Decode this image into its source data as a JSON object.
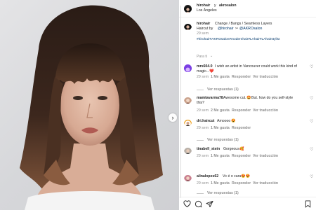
{
  "post": {
    "header": {
      "author": "hirohair",
      "connector": "y",
      "collab": "akrosalon",
      "location": "Los Ángeles"
    },
    "caption": {
      "username": "hirohair",
      "line1": "Change / Bangs / Seamless Layers",
      "line2_prefix": "Haircut by",
      "mention_hiro": "@hirohair",
      "mention_akro": "@AKROsalon",
      "hashtags": "#hirohair#AKROsalon#modernhair#LAhair#LAhairstylist",
      "time": "29 sem"
    },
    "for_you": "Para ti",
    "comments": [
      {
        "user": "mrs604.0",
        "text_line1": "I wish an artist in Vancouver could work this kind of",
        "text_line2": "magic...",
        "emoji": "❤️",
        "time": "29 sem",
        "likes": "1 Me gusta",
        "reply": "Responder",
        "translate": "Ver traducción",
        "replies": "Ver respuestas (1)"
      },
      {
        "user": "mamtavarma78",
        "text_line1": "Awesome cut. ",
        "emoji": "🤩",
        "text_line1b": " But. how do you self-style",
        "text_line2": "this?",
        "time": "29 sem",
        "likes": "2 Me gusta",
        "reply": "Responder",
        "translate": "Ver traducción",
        "replies": "Ver respuestas (1)"
      },
      {
        "user": "dri.haircut",
        "text_line1": "Amoooo",
        "emoji": "😍",
        "time": "29 sem",
        "likes": "1 Me gusta",
        "reply": "Responder",
        "replies": "Ver respuestas (1)"
      },
      {
        "user": "tinabell_stein",
        "text_line1": "Gorgeous ",
        "emoji": "🥰",
        "time": "29 sem",
        "likes": "1 Me gusta",
        "reply": "Responder",
        "translate": "Ver traducción"
      },
      {
        "user": "alinalopes62",
        "text_line1": "Vc é o cara ",
        "emoji": "😍😍",
        "time": "29 sem",
        "likes": "1 Me gusta",
        "reply": "Responder",
        "translate": "Ver traducción",
        "replies": "Ver respuestas (1)"
      }
    ]
  },
  "icons": {
    "next": "chevron-right-icon",
    "heart": "heart-icon",
    "comment": "comment-icon",
    "share": "share-icon",
    "save": "bookmark-icon"
  }
}
